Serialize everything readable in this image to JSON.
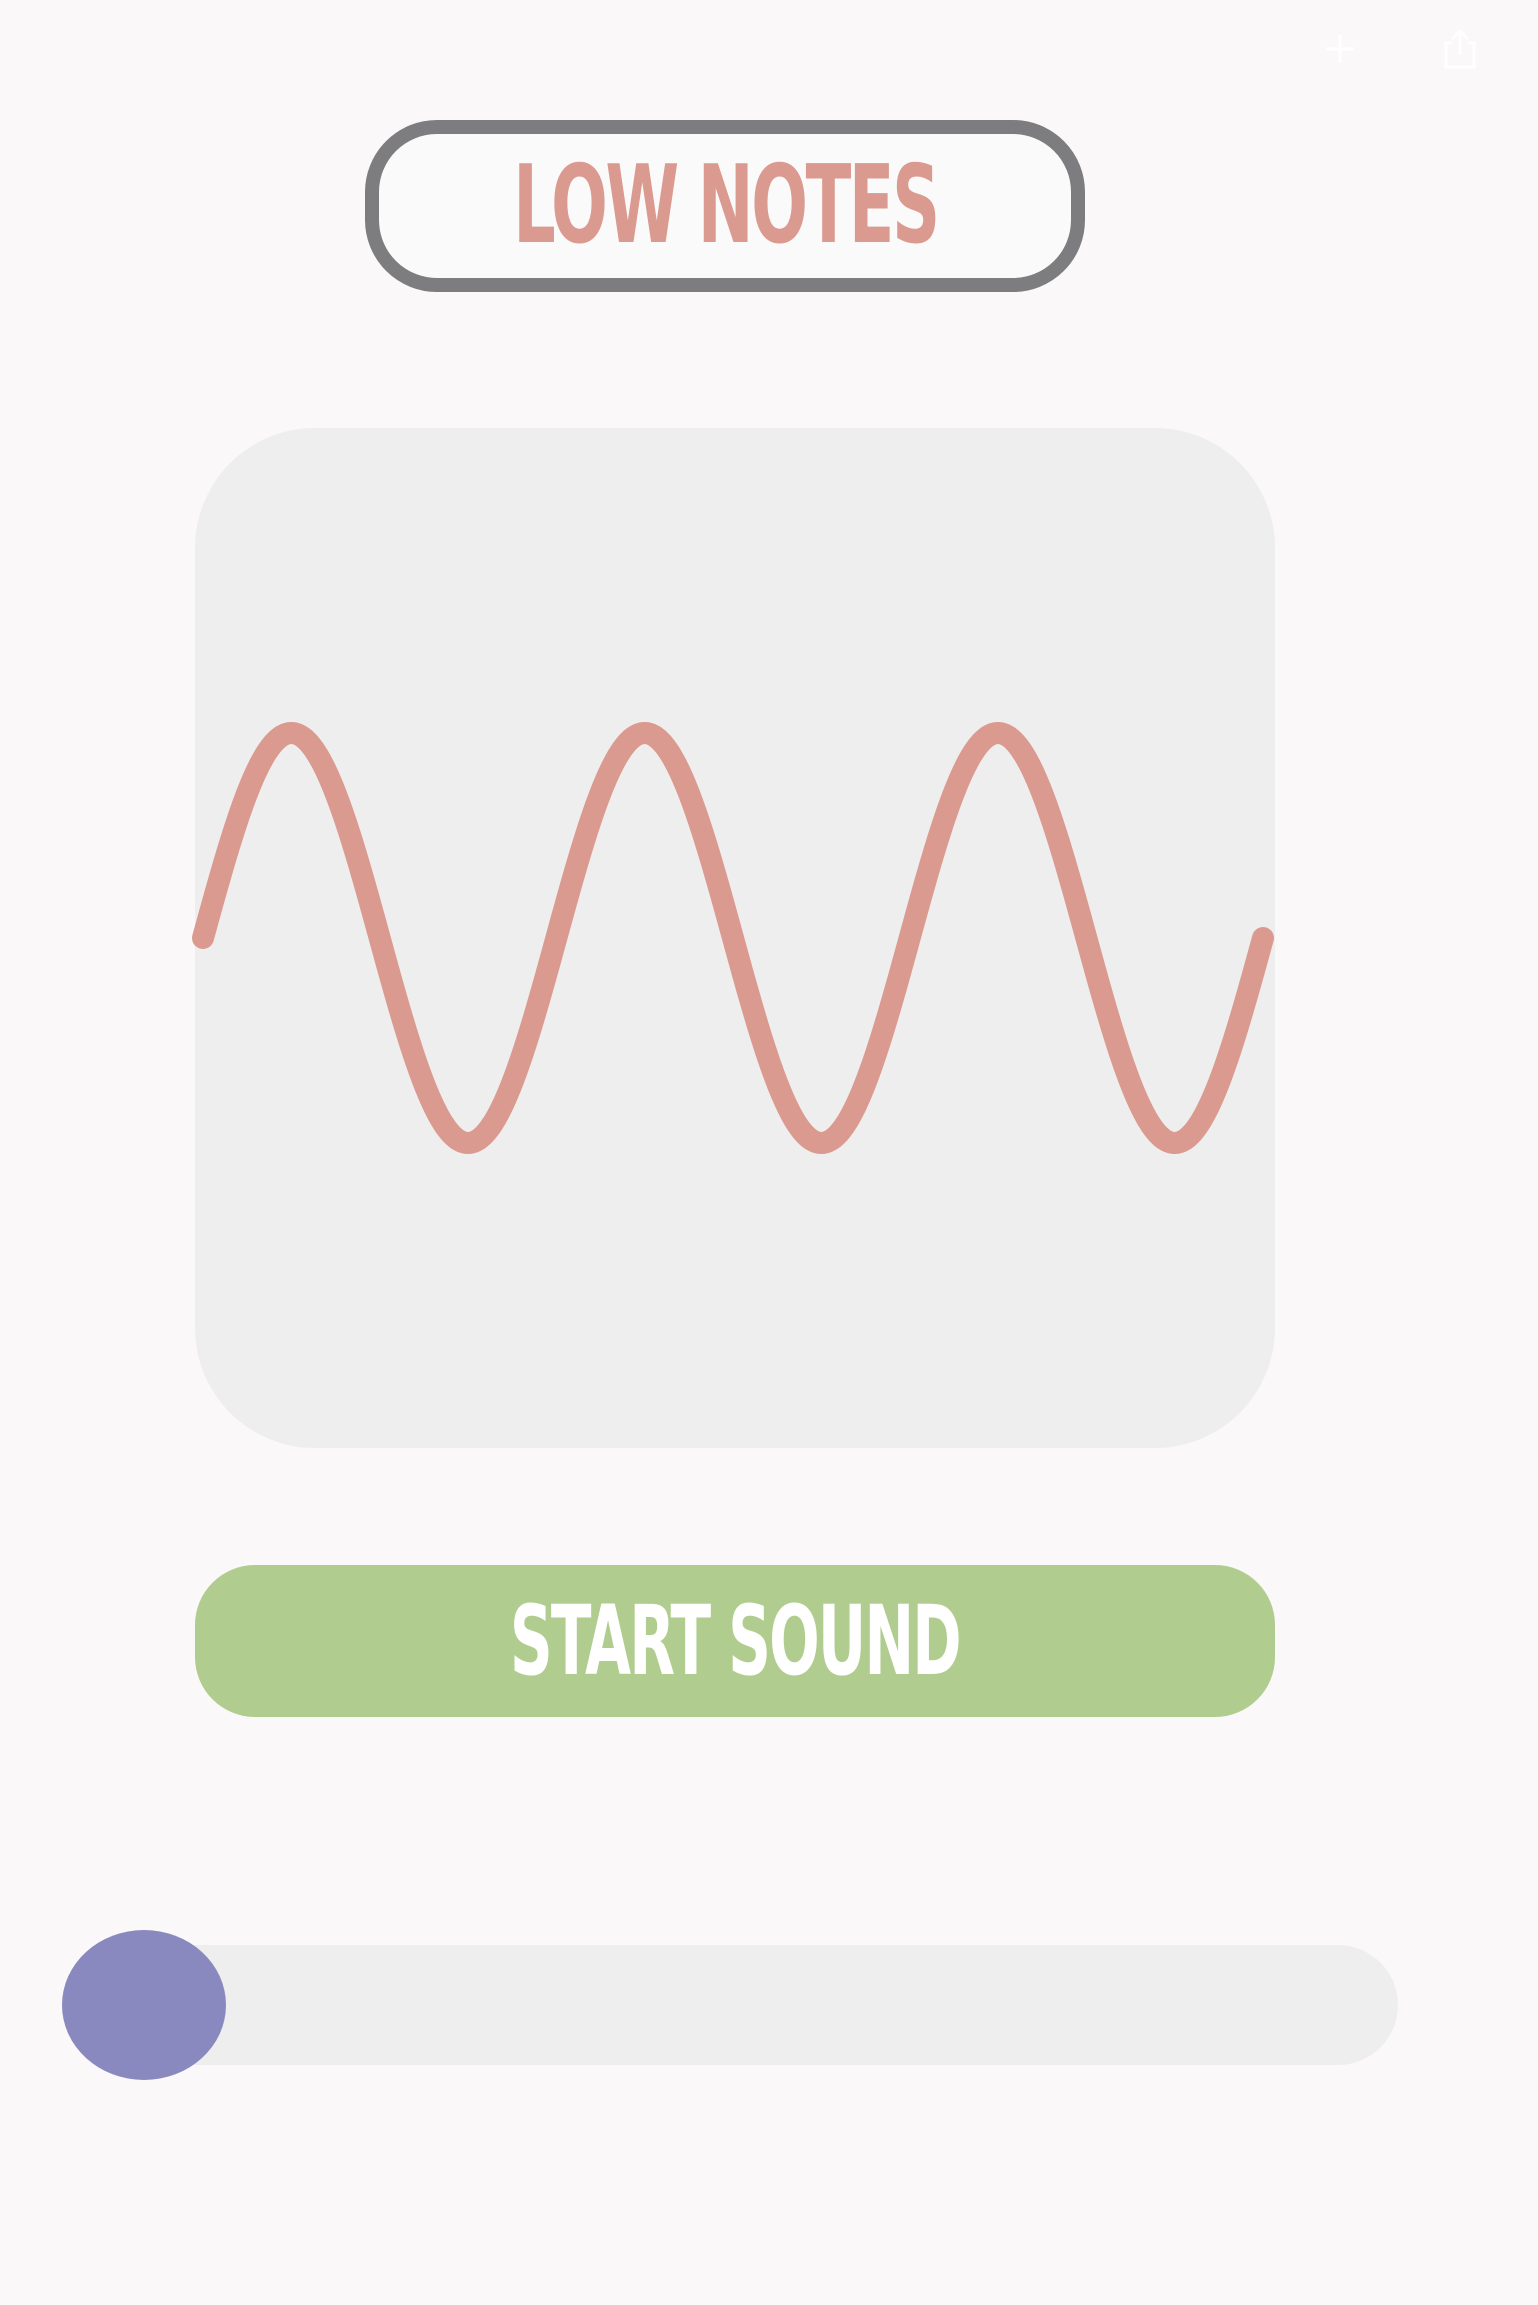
{
  "header": {
    "title": "LOW NOTES",
    "title_color": "#db9a8f",
    "border_color": "#7d7c7e"
  },
  "top_controls": [
    {
      "icon": "plus-icon"
    },
    {
      "icon": "share-icon"
    }
  ],
  "waveform": {
    "type": "sine",
    "cycles": 3,
    "stroke_color": "#db9a8f",
    "panel_color": "#efeeee"
  },
  "start_button": {
    "label": "START SOUND",
    "color": "#b0cd8f"
  },
  "slider": {
    "value": 0,
    "min": 0,
    "max": 1,
    "thumb_color": "#8a89bf",
    "track_color": "#efeeee"
  }
}
